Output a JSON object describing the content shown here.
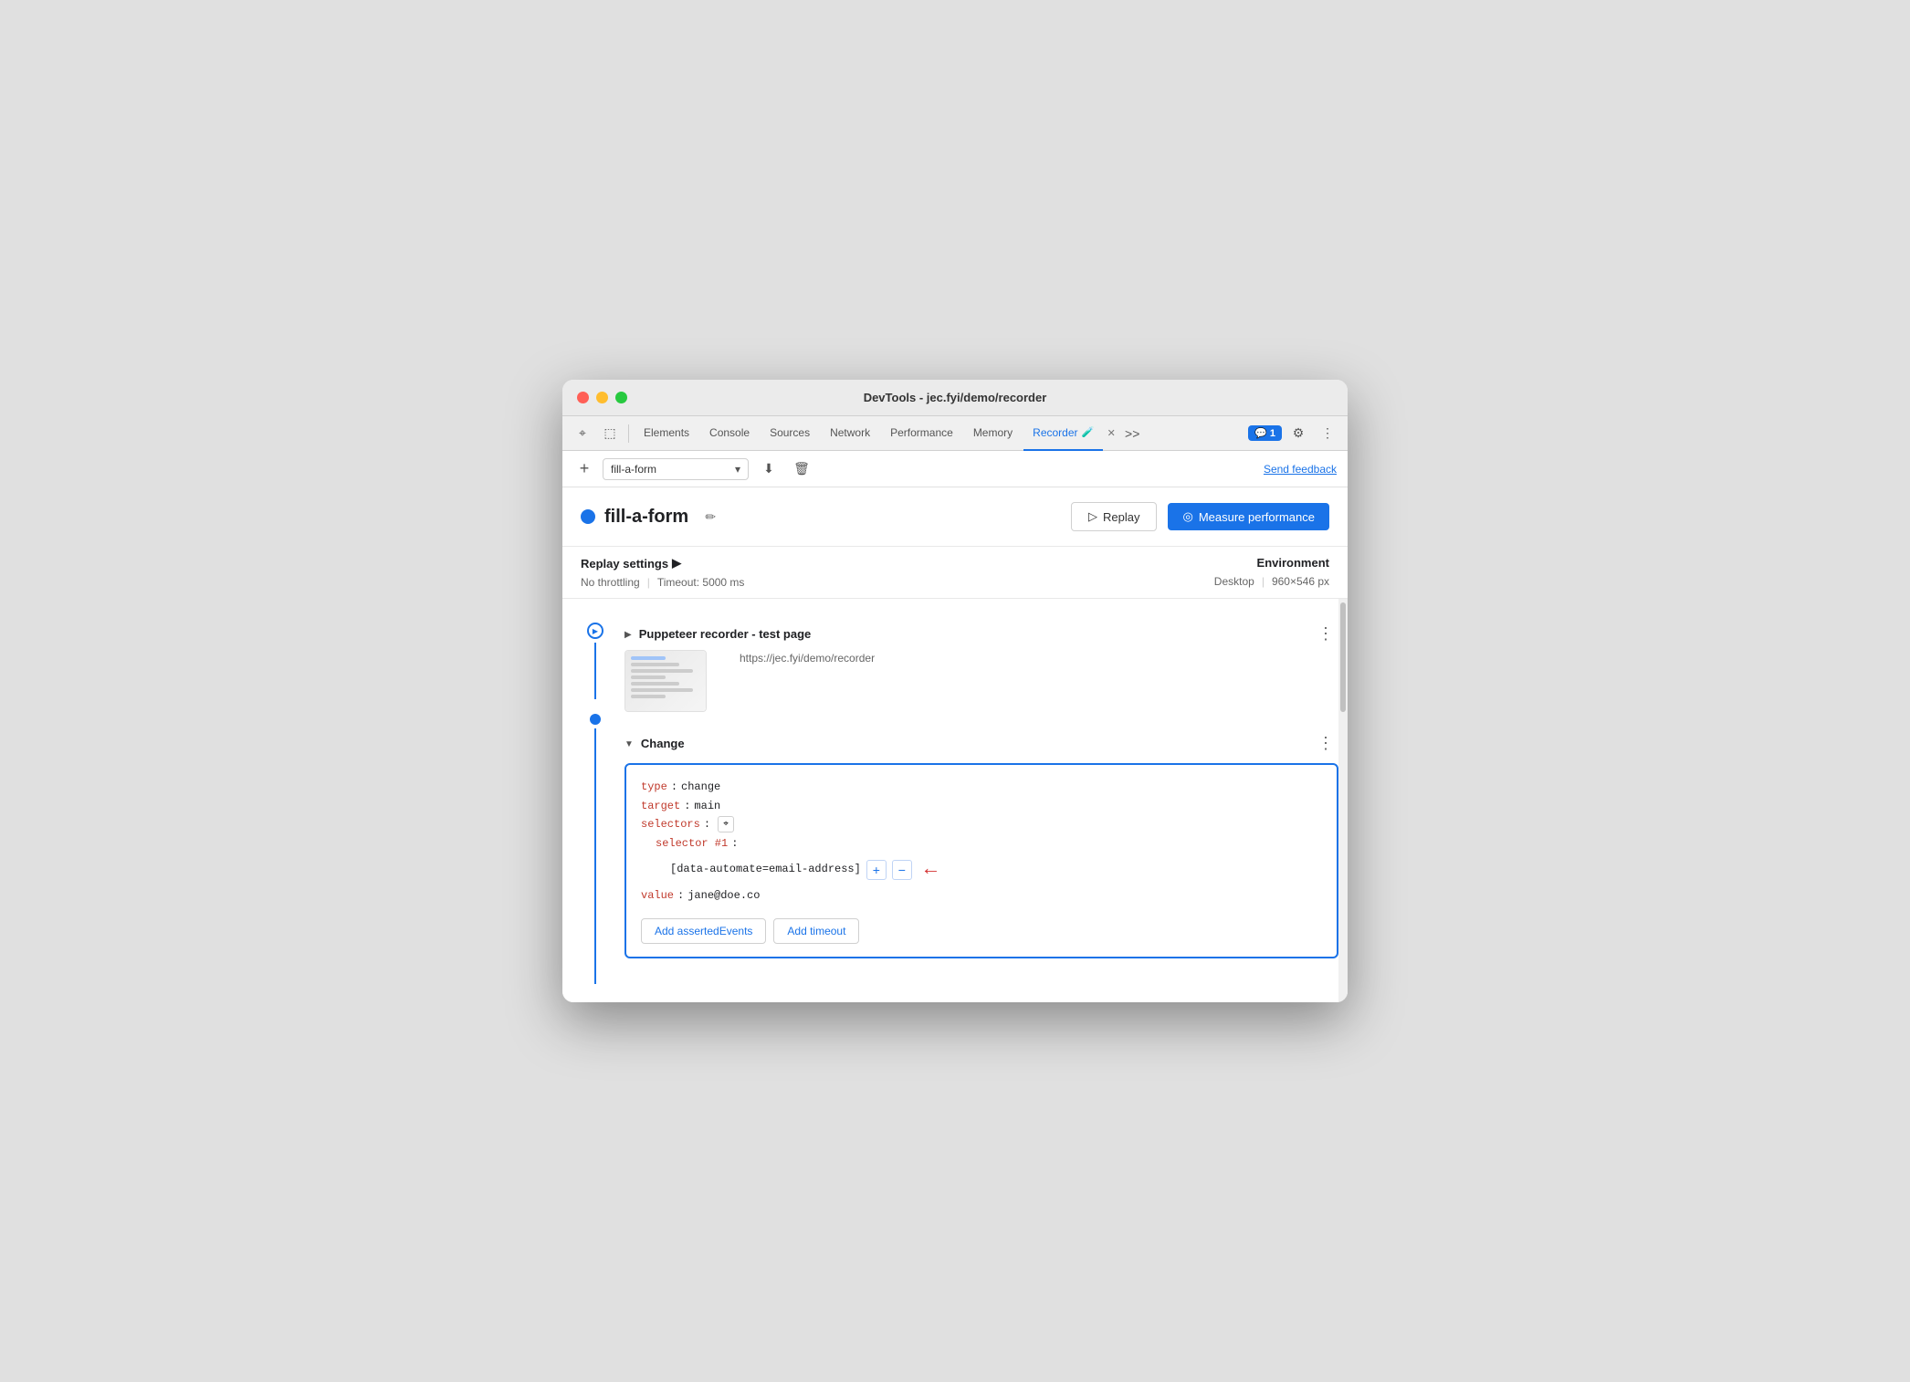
{
  "window": {
    "title": "DevTools - jec.fyi/demo/recorder"
  },
  "tabs": {
    "elements": "Elements",
    "console": "Console",
    "sources": "Sources",
    "network": "Network",
    "performance": "Performance",
    "memory": "Memory",
    "recorder": "Recorder",
    "more": ">>"
  },
  "chat_badge": "1",
  "toolbar": {
    "add_label": "+",
    "recording_name": "fill-a-form",
    "send_feedback": "Send feedback"
  },
  "recording": {
    "name": "fill-a-form",
    "dot_color": "#1a73e8",
    "replay_label": "Replay",
    "measure_perf_label": "Measure performance"
  },
  "settings": {
    "replay_settings_label": "Replay settings",
    "no_throttling": "No throttling",
    "timeout_label": "Timeout: 5000 ms",
    "environment_label": "Environment",
    "desktop_label": "Desktop",
    "resolution_label": "960×546 px"
  },
  "steps": [
    {
      "id": "step1",
      "title": "Puppeteer recorder - test page",
      "url": "https://jec.fyi/demo/recorder",
      "expanded": false,
      "has_thumbnail": true
    },
    {
      "id": "step2",
      "title": "Change",
      "expanded": true,
      "code": {
        "type_key": "type",
        "type_val": "change",
        "target_key": "target",
        "target_val": "main",
        "selectors_key": "selectors",
        "selector_num_key": "selector #1",
        "selector_val": "[data-automate=email-address]",
        "value_key": "value",
        "value_val": "jane@doe.co"
      },
      "actions": {
        "add_asserted": "Add assertedEvents",
        "add_timeout": "Add timeout"
      }
    }
  ],
  "icons": {
    "cursor": "⌖",
    "inspect": "⬚",
    "expand_more": "⋮",
    "edit_pencil": "✏",
    "play_triangle": "▷",
    "measure_icon": "◎",
    "arrow_down": "▼",
    "arrow_right": "▶",
    "chevron_right": "›",
    "download": "⬇",
    "trash": "🗑",
    "settings_gear": "⚙",
    "more_vert": "⋮",
    "chat_icon": "💬",
    "selector_icon": "⌖"
  }
}
